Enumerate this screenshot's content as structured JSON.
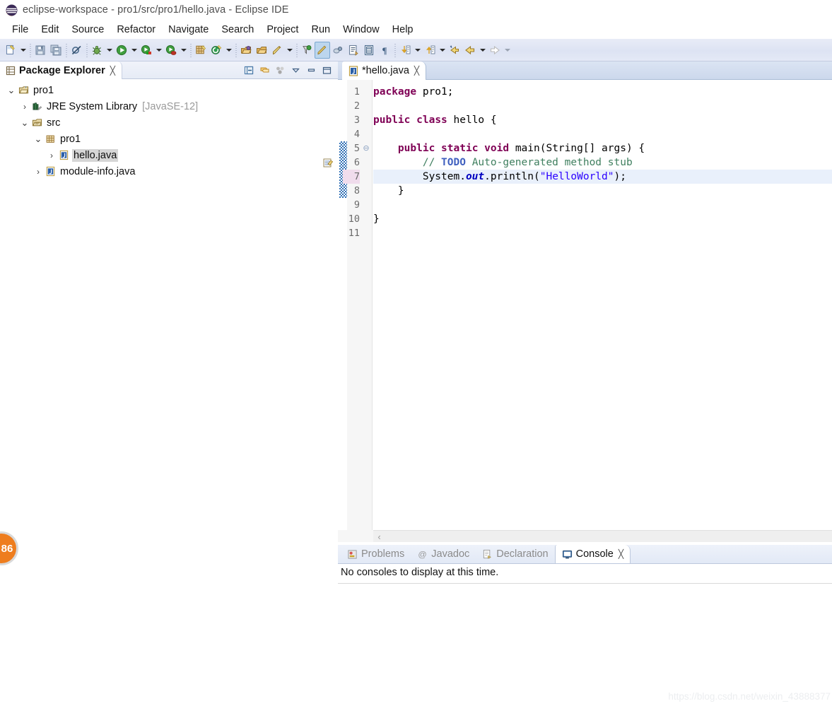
{
  "window": {
    "title": "eclipse-workspace - pro1/src/pro1/hello.java - Eclipse IDE",
    "logo_icon": "eclipse-logo-icon"
  },
  "menubar": {
    "items": [
      {
        "label": "File"
      },
      {
        "label": "Edit"
      },
      {
        "label": "Source"
      },
      {
        "label": "Refactor"
      },
      {
        "label": "Navigate"
      },
      {
        "label": "Search"
      },
      {
        "label": "Project"
      },
      {
        "label": "Run"
      },
      {
        "label": "Window"
      },
      {
        "label": "Help"
      }
    ]
  },
  "toolbar": {
    "items": [
      {
        "icon": "new-file-icon",
        "type": "button"
      },
      {
        "icon": "dropdown-arrow",
        "type": "arrow"
      },
      {
        "icon": "separator",
        "type": "sep"
      },
      {
        "icon": "save-icon",
        "type": "button"
      },
      {
        "icon": "save-all-icon",
        "type": "button"
      },
      {
        "icon": "separator",
        "type": "sep"
      },
      {
        "icon": "skip-breakpoints-icon",
        "type": "button"
      },
      {
        "icon": "separator",
        "type": "sep"
      },
      {
        "icon": "debug-bug-icon",
        "type": "button"
      },
      {
        "icon": "dropdown-arrow",
        "type": "arrow"
      },
      {
        "icon": "run-icon",
        "type": "button"
      },
      {
        "icon": "dropdown-arrow",
        "type": "arrow"
      },
      {
        "icon": "coverage-icon",
        "type": "button"
      },
      {
        "icon": "dropdown-arrow",
        "type": "arrow"
      },
      {
        "icon": "profile-icon",
        "type": "button"
      },
      {
        "icon": "dropdown-arrow",
        "type": "arrow"
      },
      {
        "icon": "separator",
        "type": "sep"
      },
      {
        "icon": "new-java-package-icon",
        "type": "button"
      },
      {
        "icon": "new-java-class-icon",
        "type": "button"
      },
      {
        "icon": "dropdown-arrow",
        "type": "arrow"
      },
      {
        "icon": "separator",
        "type": "sep"
      },
      {
        "icon": "open-type-icon",
        "type": "button"
      },
      {
        "icon": "open-task-icon",
        "type": "button"
      },
      {
        "icon": "quick-fix-icon",
        "type": "button"
      },
      {
        "icon": "dropdown-arrow",
        "type": "arrow"
      },
      {
        "icon": "separator",
        "type": "sep"
      },
      {
        "icon": "search-icon",
        "type": "button"
      },
      {
        "icon": "toggle-mark-occurrences-icon",
        "type": "button",
        "active": true
      },
      {
        "icon": "link-icon",
        "type": "button"
      },
      {
        "icon": "next-annotation-icon",
        "type": "button"
      },
      {
        "icon": "show-whitespace-icon",
        "type": "button"
      },
      {
        "icon": "pilcrow-icon",
        "type": "button"
      },
      {
        "icon": "separator",
        "type": "sep"
      },
      {
        "icon": "next-edit-location-icon",
        "type": "button"
      },
      {
        "icon": "dropdown-arrow",
        "type": "arrow"
      },
      {
        "icon": "previous-edit-location-icon",
        "type": "button"
      },
      {
        "icon": "dropdown-arrow",
        "type": "arrow"
      },
      {
        "icon": "back-history-icon",
        "type": "button"
      },
      {
        "icon": "back-icon",
        "type": "button"
      },
      {
        "icon": "dropdown-arrow",
        "type": "arrow"
      },
      {
        "icon": "forward-icon-disabled",
        "type": "button"
      },
      {
        "icon": "dropdown-arrow-disabled",
        "type": "arrow"
      }
    ]
  },
  "explorer": {
    "tab": {
      "label": "Package Explorer",
      "icon": "package-explorer-icon",
      "close": "╳"
    },
    "tools": [
      {
        "icon": "collapse-all-icon"
      },
      {
        "icon": "link-with-editor-icon"
      },
      {
        "icon": "view-menu-dots-icon"
      },
      {
        "icon": "chevron-down-icon"
      },
      {
        "icon": "minimize-icon"
      },
      {
        "icon": "maximize-icon"
      }
    ],
    "tree": [
      {
        "label": "pro1",
        "icon": "java-project-icon",
        "twist": "⌄",
        "indent": 0,
        "selected": false,
        "suffix": ""
      },
      {
        "label": "JRE System Library",
        "icon": "jre-library-icon",
        "twist": "›",
        "indent": 1,
        "selected": false,
        "suffix": "[JavaSE-12]"
      },
      {
        "label": "src",
        "icon": "source-folder-icon",
        "twist": "⌄",
        "indent": 1,
        "selected": false,
        "suffix": ""
      },
      {
        "label": "pro1",
        "icon": "package-icon",
        "twist": "⌄",
        "indent": 2,
        "selected": false,
        "suffix": ""
      },
      {
        "label": "hello.java",
        "icon": "java-file-icon",
        "twist": "›",
        "indent": 3,
        "selected": true,
        "suffix": ""
      },
      {
        "label": "module-info.java",
        "icon": "java-file-icon",
        "twist": "›",
        "indent": 2,
        "selected": false,
        "suffix": ""
      }
    ]
  },
  "editor": {
    "tab": {
      "label": "*hello.java",
      "icon": "java-file-icon",
      "close": "╳",
      "dirty": true
    },
    "current_line": 7,
    "change_bar_lines": [
      5,
      6,
      7,
      8
    ],
    "fold_lines": [
      5
    ],
    "task_marker_line": 6,
    "lines": [
      {
        "n": 1,
        "segments": [
          {
            "t": "package",
            "c": "kw"
          },
          {
            "t": " pro1;",
            "c": ""
          }
        ]
      },
      {
        "n": 2,
        "segments": []
      },
      {
        "n": 3,
        "segments": [
          {
            "t": "public",
            "c": "kw"
          },
          {
            "t": " ",
            "c": ""
          },
          {
            "t": "class",
            "c": "kw"
          },
          {
            "t": " hello {",
            "c": ""
          }
        ]
      },
      {
        "n": 4,
        "segments": []
      },
      {
        "n": 5,
        "segments": [
          {
            "t": "    ",
            "c": ""
          },
          {
            "t": "public",
            "c": "kw"
          },
          {
            "t": " ",
            "c": ""
          },
          {
            "t": "static",
            "c": "kw"
          },
          {
            "t": " ",
            "c": ""
          },
          {
            "t": "void",
            "c": "kw"
          },
          {
            "t": " main(String[] args) {",
            "c": ""
          }
        ]
      },
      {
        "n": 6,
        "segments": [
          {
            "t": "        ",
            "c": ""
          },
          {
            "t": "// ",
            "c": "cmt"
          },
          {
            "t": "TODO",
            "c": "todo"
          },
          {
            "t": " Auto-generated method stub",
            "c": "cmt"
          }
        ]
      },
      {
        "n": 7,
        "segments": [
          {
            "t": "        System.",
            "c": ""
          },
          {
            "t": "out",
            "c": "fld"
          },
          {
            "t": ".println(",
            "c": ""
          },
          {
            "t": "\"HelloWorld\"",
            "c": "str"
          },
          {
            "t": ");",
            "c": ""
          }
        ]
      },
      {
        "n": 8,
        "segments": [
          {
            "t": "    }",
            "c": ""
          }
        ]
      },
      {
        "n": 9,
        "segments": []
      },
      {
        "n": 10,
        "segments": [
          {
            "t": "}",
            "c": ""
          }
        ]
      },
      {
        "n": 11,
        "segments": []
      }
    ],
    "hscroll_left_arrow": "‹"
  },
  "bottom_panel": {
    "tabs": [
      {
        "label": "Problems",
        "icon": "problems-icon",
        "active": false
      },
      {
        "label": "Javadoc",
        "icon": "javadoc-at-icon",
        "active": false
      },
      {
        "label": "Declaration",
        "icon": "declaration-icon",
        "active": false
      },
      {
        "label": "Console",
        "icon": "console-icon",
        "active": true,
        "close": "╳"
      }
    ],
    "message": "No consoles to display at this time."
  },
  "badge": {
    "text": "86"
  },
  "watermark": {
    "text": "https://blog.csdn.net/weixin_43888377"
  },
  "colors": {
    "keyword": "#7f0055",
    "string": "#2a00ff",
    "comment": "#3f7f5f",
    "todo": "#3f5fbf",
    "field": "#0000c0",
    "current_line": "#e9f0fb",
    "current_line_number": "#f0dcec",
    "selection": "#d6d6d6",
    "change_bar": "#2f6fb5",
    "badge_bg": "#ee7d1e",
    "toolbar_bg": "#dde3f3"
  }
}
